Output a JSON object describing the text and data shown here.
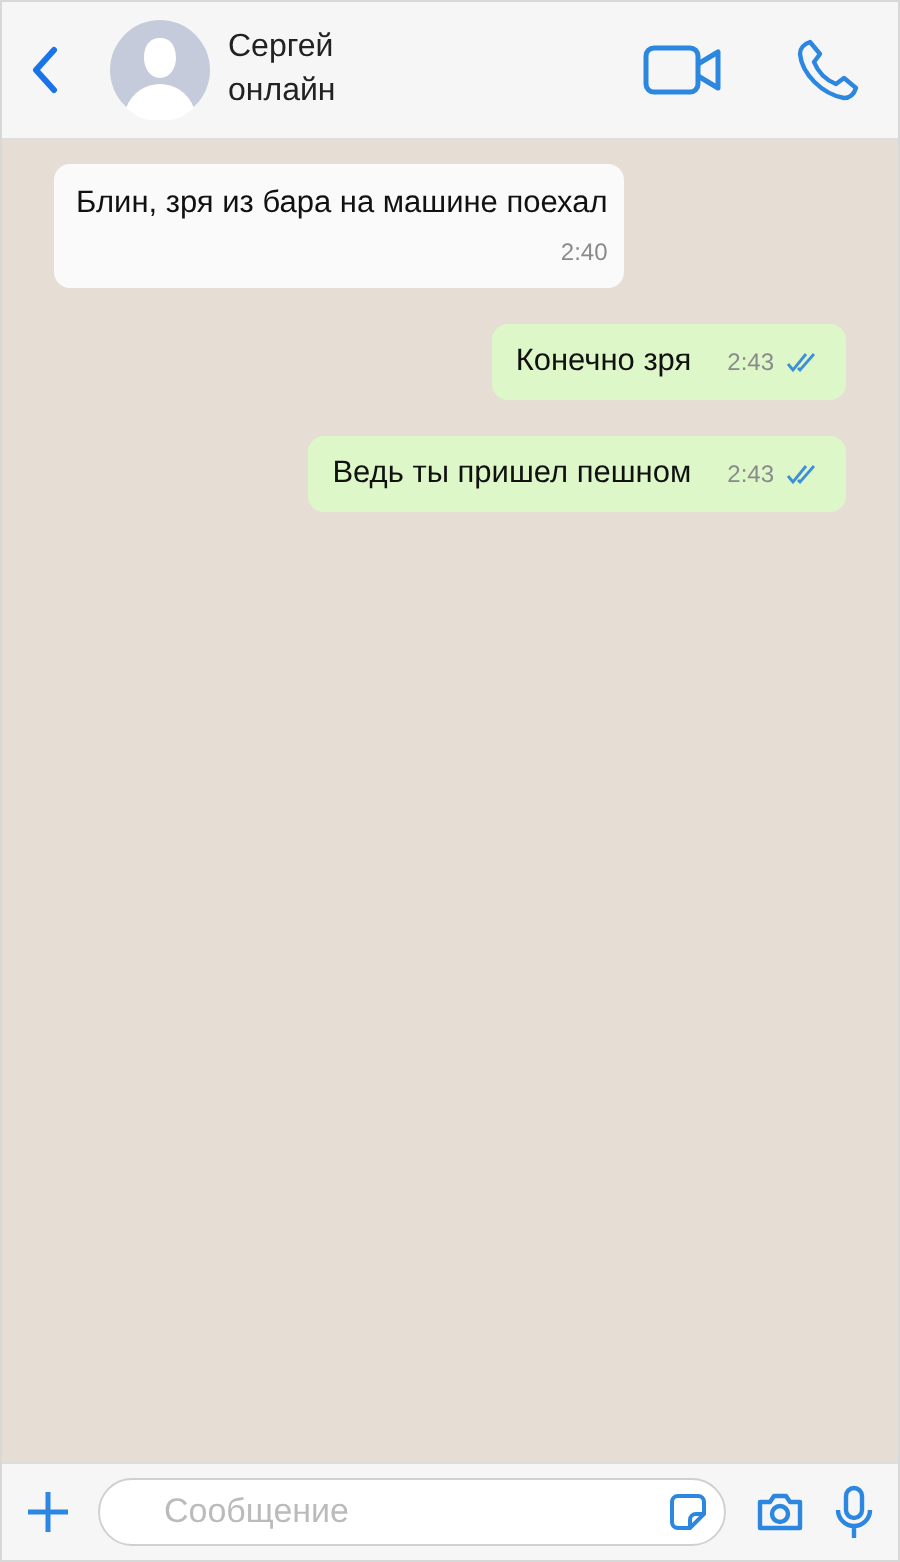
{
  "header": {
    "name": "Сергей",
    "status": "онлайн"
  },
  "messages": [
    {
      "kind": "incoming",
      "text": "Блин, зря из бара на машине поехал",
      "time": "2:40"
    },
    {
      "kind": "outgoing",
      "text": "Конечно зря",
      "time": "2:43",
      "read": true
    },
    {
      "kind": "outgoing",
      "text": "Ведь ты пришел пешном",
      "time": "2:43",
      "read": true
    }
  ],
  "composer": {
    "placeholder": "Сообщение"
  }
}
